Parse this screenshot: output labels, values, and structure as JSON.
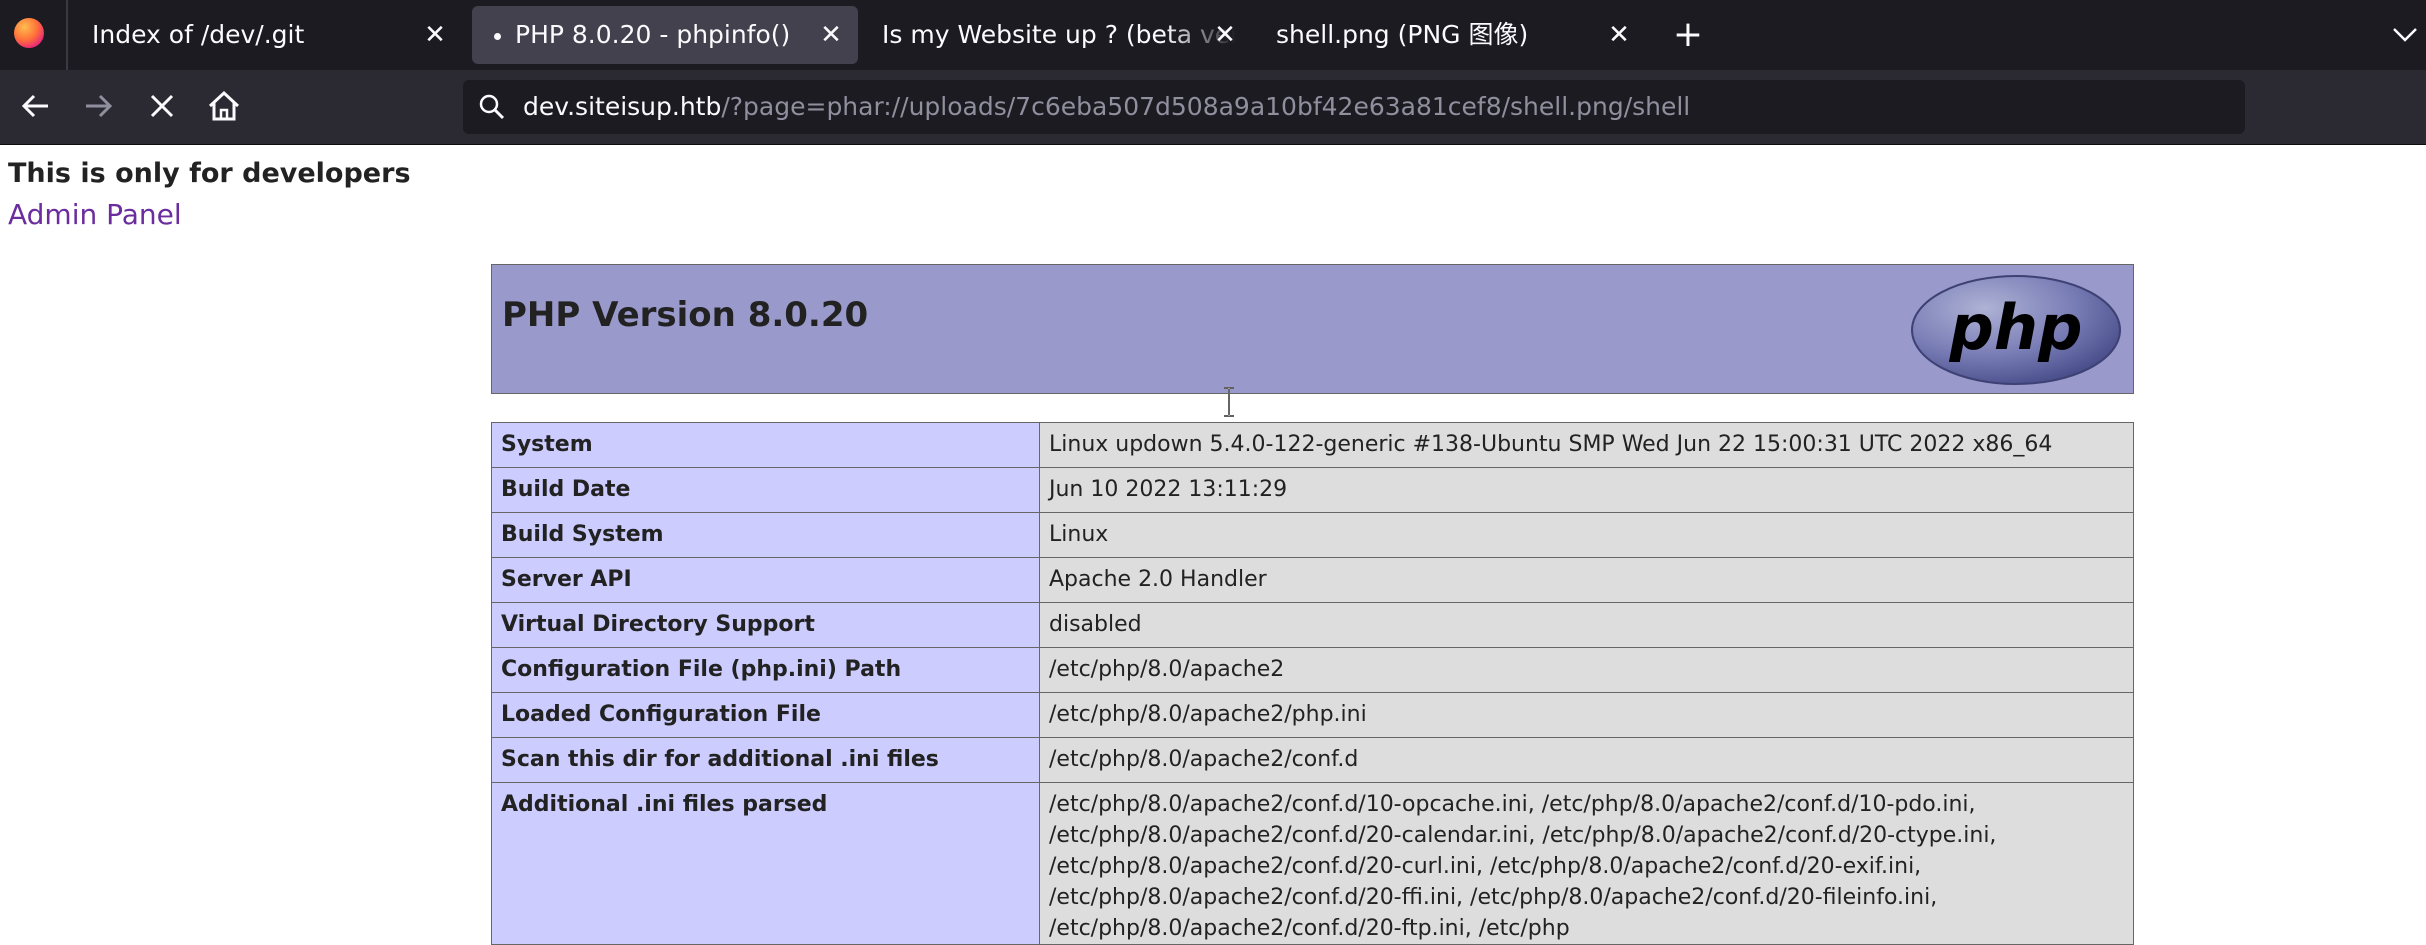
{
  "browser": {
    "tabs": [
      {
        "title": "Index of /dev/.git",
        "active": false
      },
      {
        "title": "PHP 8.0.20 - phpinfo()",
        "active": true
      },
      {
        "title": "Is my Website up ? (beta version)",
        "active": false
      },
      {
        "title": "shell.png (PNG 图像)",
        "active": false
      }
    ],
    "close_glyph": "✕",
    "new_tab_glyph": "+",
    "url": {
      "host": "dev.siteisup.htb",
      "path": "/?page=phar://uploads/7c6eba507d508a9a10bf42e63a81cef8/shell.png/shell"
    },
    "icons": {
      "back": "arrow-left-icon",
      "forward": "arrow-right-icon",
      "stop": "close-icon",
      "home": "home-icon",
      "search": "search-icon",
      "tab_list": "chevron-down-icon"
    }
  },
  "page": {
    "heading": "This is only for developers",
    "admin_link": "Admin Panel",
    "php_header": {
      "version_title": "PHP Version 8.0.20",
      "logo_text": "php"
    },
    "info_rows": [
      {
        "label": "System",
        "value": "Linux updown 5.4.0-122-generic #138-Ubuntu SMP Wed Jun 22 15:00:31 UTC 2022 x86_64"
      },
      {
        "label": "Build Date",
        "value": "Jun 10 2022 13:11:29"
      },
      {
        "label": "Build System",
        "value": "Linux"
      },
      {
        "label": "Server API",
        "value": "Apache 2.0 Handler"
      },
      {
        "label": "Virtual Directory Support",
        "value": "disabled"
      },
      {
        "label": "Configuration File (php.ini) Path",
        "value": "/etc/php/8.0/apache2"
      },
      {
        "label": "Loaded Configuration File",
        "value": "/etc/php/8.0/apache2/php.ini"
      },
      {
        "label": "Scan this dir for additional .ini files",
        "value": "/etc/php/8.0/apache2/conf.d"
      },
      {
        "label": "Additional .ini files parsed",
        "value": "/etc/php/8.0/apache2/conf.d/10-opcache.ini, /etc/php/8.0/apache2/conf.d/10-pdo.ini, /etc/php/8.0/apache2/conf.d/20-calendar.ini, /etc/php/8.0/apache2/conf.d/20-ctype.ini, /etc/php/8.0/apache2/conf.d/20-curl.ini, /etc/php/8.0/apache2/conf.d/20-exif.ini, /etc/php/8.0/apache2/conf.d/20-ffi.ini, /etc/php/8.0/apache2/conf.d/20-fileinfo.ini, /etc/php/8.0/apache2/conf.d/20-ftp.ini, /etc/php"
      }
    ]
  }
}
